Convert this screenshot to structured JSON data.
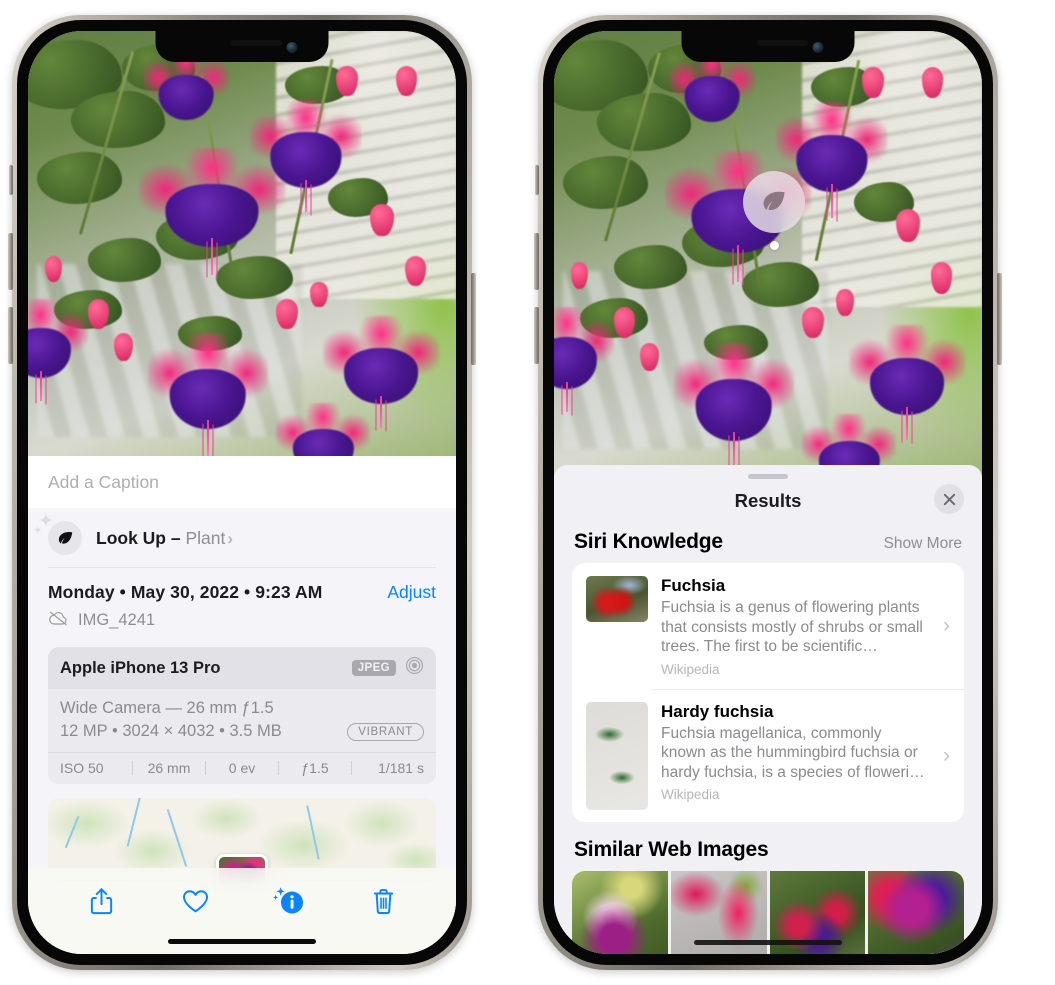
{
  "left_phone": {
    "caption_placeholder": "Add a Caption",
    "lookup": {
      "label": "Look Up –",
      "subject": "Plant",
      "chevron": "›",
      "icon": "leaf-icon"
    },
    "metadata": {
      "date_line": "Monday • May 30, 2022 • 9:23 AM",
      "adjust_label": "Adjust",
      "filename": "IMG_4241",
      "cloud_icon": "cloud-slash-icon"
    },
    "camera_card": {
      "device": "Apple iPhone 13 Pro",
      "format_badge": "JPEG",
      "lens_icon": "aperture-icon",
      "lens_line": "Wide Camera — 26 mm ƒ1.5",
      "specs_line": "12 MP • 3024 × 4032 • 3.5 MB",
      "style_badge": "VIBRANT",
      "exif": [
        "ISO 50",
        "26 mm",
        "0 ev",
        "ƒ1.5",
        "1/181 s"
      ]
    },
    "toolbar": [
      {
        "name": "share-button",
        "icon": "share-icon"
      },
      {
        "name": "favorite-button",
        "icon": "heart-icon"
      },
      {
        "name": "info-button",
        "icon": "info-sparkle-icon"
      },
      {
        "name": "delete-button",
        "icon": "trash-icon"
      }
    ]
  },
  "right_phone": {
    "badge": {
      "icon": "leaf-icon"
    },
    "sheet": {
      "title": "Results",
      "close_icon": "close-icon"
    },
    "siri_knowledge": {
      "heading": "Siri Knowledge",
      "action": "Show More",
      "items": [
        {
          "title": "Fuchsia",
          "description": "Fuchsia is a genus of flowering plants that consists mostly of shrubs or small trees. The first to be scientific…",
          "source": "Wikipedia",
          "chevron": "›"
        },
        {
          "title": "Hardy fuchsia",
          "description": "Fuchsia magellanica, commonly known as the hummingbird fuchsia or hardy fuchsia, is a species of floweri…",
          "source": "Wikipedia",
          "chevron": "›"
        }
      ]
    },
    "similar_web_images": {
      "heading": "Similar Web Images",
      "tiles": [
        "fuchsia-thumb-1",
        "fuchsia-thumb-2",
        "fuchsia-thumb-3",
        "fuchsia-thumb-4"
      ]
    }
  },
  "colors": {
    "accent_blue": "#0a84ff",
    "sheet_bg": "#f1f0f5",
    "card_bg": "#ffffff",
    "secondary_text": "#8e8e93"
  }
}
